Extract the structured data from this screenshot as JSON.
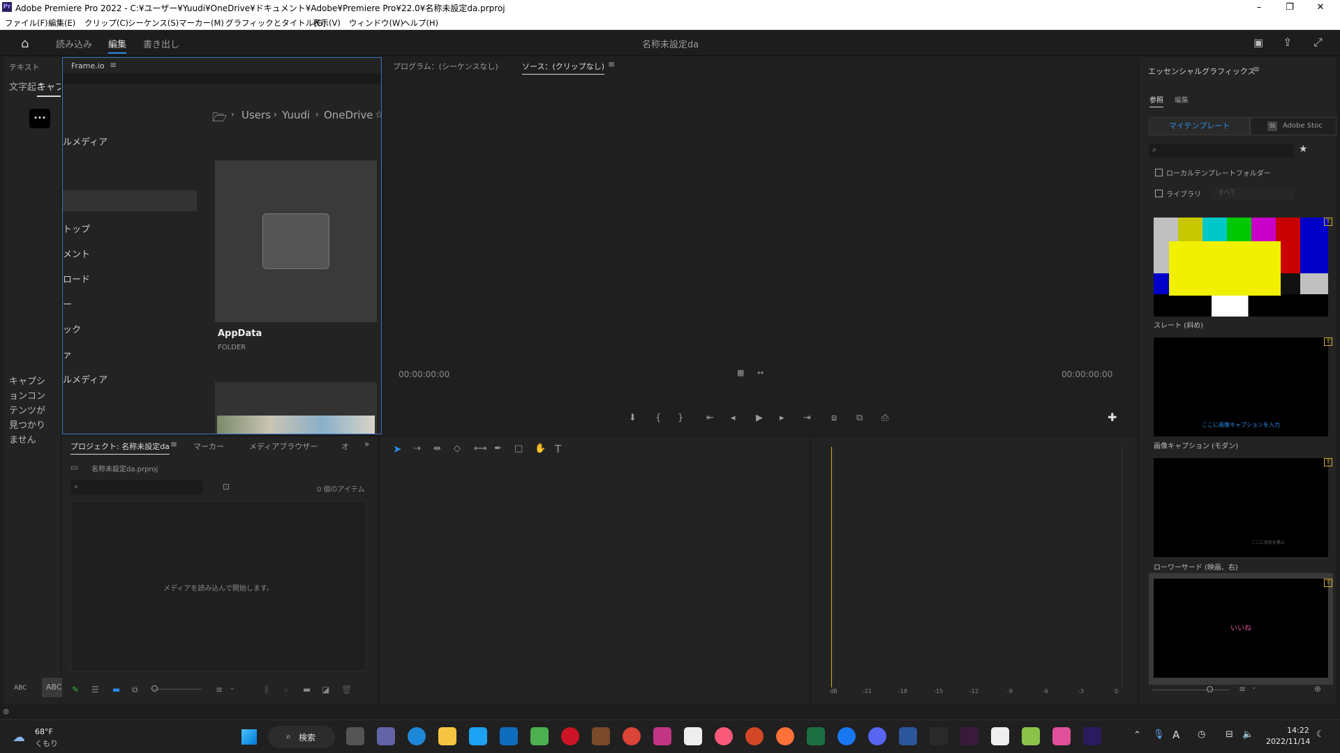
{
  "titlebar": {
    "title": "Adobe Premiere Pro 2022 - C:¥ユーザー¥Yuudi¥OneDrive¥ドキュメント¥Adobe¥Premiere Pro¥22.0¥名称未設定da.prproj",
    "pr": "Pr",
    "min": "–",
    "max": "❐",
    "close": "✕"
  },
  "menu": [
    "ファイル(F)",
    "編集(E)",
    "クリップ(C)",
    "シーケンス(S)",
    "マーカー(M)",
    "グラフィックとタイトル(G)",
    "表示(V)",
    "ウィンドウ(W)",
    "ヘルプ(H)"
  ],
  "workspace": {
    "tabs": [
      "読み込み",
      "編集",
      "書き出し"
    ],
    "project_title": "名称未設定da"
  },
  "left_panel": {
    "tab": "テキスト",
    "sub_tab": "文字起こし",
    "sub_tab2": "キャプ",
    "more": "•••",
    "message": "キャプションコンテンツが見つかりません",
    "abc1": "ABC",
    "abc2": "ABC"
  },
  "frameio": {
    "tab": "Frame.io",
    "breadcrumb": [
      "Users",
      "Yuudi",
      "OneDrive"
    ],
    "left_items": [
      "ルメディア",
      "トップ",
      "メント",
      "ロード",
      "ー",
      "ック",
      "ァ",
      "ルメディア"
    ],
    "folder_name": "AppData",
    "folder_type": "FOLDER"
  },
  "program": {
    "tab_program": "プログラム：(シーケンスなし)",
    "tab_source": "ソース：(クリップなし)",
    "tc_left": "00:00:00:00",
    "tc_right": "00:00:00:00"
  },
  "project": {
    "tabs": [
      "プロジェクト: 名称未設定da",
      "マーカー",
      "メディアブラウザー",
      "オ"
    ],
    "file": "名称未設定da.prproj",
    "item_count": "0 個のアイテム",
    "empty_msg": "メディアを読み込んで開始します。"
  },
  "audio_meter": {
    "scale": [
      "dB",
      "-21",
      "-18",
      "-15",
      "-12",
      "-9",
      "-6",
      "-3",
      "0"
    ]
  },
  "essential_graphics": {
    "title": "エッセンシャルグラフィックス",
    "tabs": [
      "参照",
      "編集"
    ],
    "sub_tabs": [
      "マイテンプレート",
      "Adobe Stoc"
    ],
    "checkbox1": "ローカルテンプレートフォルダー",
    "checkbox2": "ライブラリ",
    "library_select": "すべて",
    "templates": [
      {
        "name": "スレート (斜め)"
      },
      {
        "name": "画像キャプション (モダン)",
        "preview_text": "ここに画像キャプションを入力"
      },
      {
        "name": "ローワーサード (映画、右)",
        "preview_text": "ここに名前を挿入"
      },
      {
        "name": "",
        "preview_text": "いいね"
      }
    ]
  },
  "taskbar": {
    "weather_temp": "68°F",
    "weather_cond": "くもり",
    "search": "検索",
    "time": "14:22",
    "date": "2022/11/14"
  }
}
